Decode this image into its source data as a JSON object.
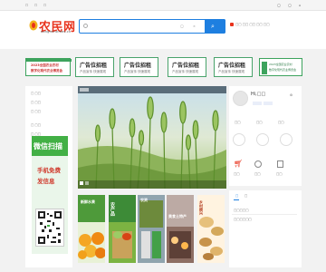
{
  "topbar": {
    "left_items": [
      "☐ ",
      "☐ ",
      "☐ "
    ],
    "right_items": [
      "◯",
      "◯",
      "⌂"
    ]
  },
  "logo": {
    "cn": "农民网",
    "en": "nongmintimes.cn"
  },
  "search": {
    "placeholder_chip": "◯",
    "button_icon": "⌕"
  },
  "ads": {
    "left_promo": {
      "line1": "2023全国农业农村",
      "line2": "数字化现代农业博览会"
    },
    "boxes": [
      {
        "title": "广告位招租",
        "sub": "产品宣传  快速展现"
      },
      {
        "title": "广告位招租",
        "sub": "产品宣传  快速展现"
      },
      {
        "title": "广告位招租",
        "sub": "产品宣传  快速展现"
      },
      {
        "title": "广告位招租",
        "sub": "产品宣传  快速展现"
      }
    ],
    "right_promo": {
      "line1": "2023全国农业农村",
      "line2": "数字化现代农业博览会"
    }
  },
  "sidebar": {
    "menu": [
      "□ □□",
      "□ □□",
      "□ □□",
      "□ □□",
      "□ □□"
    ],
    "wechat_title": "微信扫描",
    "wechat_line1": "手机免费",
    "wechat_line2": "发信息"
  },
  "user_panel": {
    "greeting": "Hi,□□",
    "stats": [
      "□□",
      "□□",
      "□□"
    ]
  },
  "news_panel": {
    "tabs": [
      "□",
      "□"
    ]
  },
  "tiles": [
    {
      "label": "新鲜水果"
    },
    {
      "label": "农产品"
    },
    {
      "label": "农资"
    },
    {
      "label": "美食土特产"
    },
    {
      "label": "乡村振兴"
    }
  ]
}
